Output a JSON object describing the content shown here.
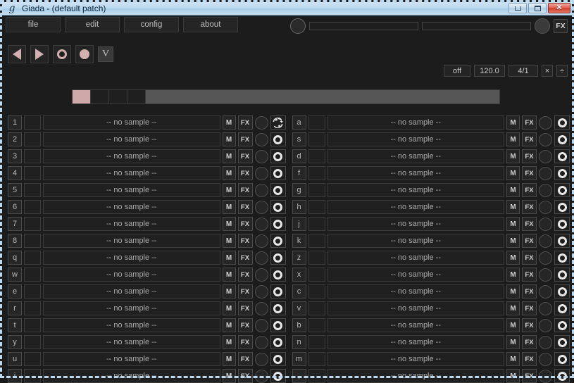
{
  "window": {
    "logo": "g",
    "title": "Giada - (default patch)",
    "buttons": {
      "minimize": "minimize-button",
      "maximize": "maximize-button",
      "close": "✕"
    }
  },
  "menu": {
    "items": [
      {
        "label": "file"
      },
      {
        "label": "edit"
      },
      {
        "label": "config"
      },
      {
        "label": "about"
      }
    ]
  },
  "io": {
    "fx_label": "FX",
    "in_meter": "input-meter",
    "out_meter": "output-meter"
  },
  "transport": {
    "rewind": "rewind-button",
    "play": "play-button",
    "record_action": "action-record-button",
    "record_input": "input-record-button",
    "metronome": "V"
  },
  "bpm_bar": {
    "quantizer": "off",
    "bpm": "120.0",
    "beats": "4/1",
    "multiply": "×",
    "divide": "÷"
  },
  "beat_meter": {
    "total_cells": 4,
    "active_cell": 1
  },
  "channels": {
    "sample_placeholder": "-- no sample --",
    "mute_label": "M",
    "fx_label": "FX",
    "left": [
      {
        "key": "1",
        "sample": "-- no sample --",
        "mode": "loop"
      },
      {
        "key": "2",
        "sample": "-- no sample --",
        "mode": "oneshot"
      },
      {
        "key": "3",
        "sample": "-- no sample --",
        "mode": "oneshot"
      },
      {
        "key": "4",
        "sample": "-- no sample --",
        "mode": "oneshot"
      },
      {
        "key": "5",
        "sample": "-- no sample --",
        "mode": "oneshot"
      },
      {
        "key": "6",
        "sample": "-- no sample --",
        "mode": "oneshot"
      },
      {
        "key": "7",
        "sample": "-- no sample --",
        "mode": "oneshot"
      },
      {
        "key": "8",
        "sample": "-- no sample --",
        "mode": "oneshot"
      },
      {
        "key": "q",
        "sample": "-- no sample --",
        "mode": "oneshot"
      },
      {
        "key": "w",
        "sample": "-- no sample --",
        "mode": "oneshot"
      },
      {
        "key": "e",
        "sample": "-- no sample --",
        "mode": "oneshot"
      },
      {
        "key": "r",
        "sample": "-- no sample --",
        "mode": "oneshot"
      },
      {
        "key": "t",
        "sample": "-- no sample --",
        "mode": "oneshot"
      },
      {
        "key": "y",
        "sample": "-- no sample --",
        "mode": "oneshot"
      },
      {
        "key": "u",
        "sample": "-- no sample --",
        "mode": "oneshot"
      },
      {
        "key": "i",
        "sample": "-- no sample --",
        "mode": "oneshot"
      }
    ],
    "right": [
      {
        "key": "a",
        "sample": "-- no sample --",
        "mode": "oneshot"
      },
      {
        "key": "s",
        "sample": "-- no sample --",
        "mode": "oneshot"
      },
      {
        "key": "d",
        "sample": "-- no sample --",
        "mode": "oneshot"
      },
      {
        "key": "f",
        "sample": "-- no sample --",
        "mode": "oneshot"
      },
      {
        "key": "g",
        "sample": "-- no sample --",
        "mode": "oneshot"
      },
      {
        "key": "h",
        "sample": "-- no sample --",
        "mode": "oneshot"
      },
      {
        "key": "j",
        "sample": "-- no sample --",
        "mode": "oneshot"
      },
      {
        "key": "k",
        "sample": "-- no sample --",
        "mode": "oneshot"
      },
      {
        "key": "z",
        "sample": "-- no sample --",
        "mode": "oneshot"
      },
      {
        "key": "x",
        "sample": "-- no sample --",
        "mode": "oneshot"
      },
      {
        "key": "c",
        "sample": "-- no sample --",
        "mode": "oneshot"
      },
      {
        "key": "v",
        "sample": "-- no sample --",
        "mode": "oneshot"
      },
      {
        "key": "b",
        "sample": "-- no sample --",
        "mode": "oneshot"
      },
      {
        "key": "n",
        "sample": "-- no sample --",
        "mode": "oneshot"
      },
      {
        "key": "m",
        "sample": "-- no sample --",
        "mode": "oneshot"
      },
      {
        "key": ",",
        "sample": "-- no sample --",
        "mode": "oneshot"
      }
    ]
  },
  "colors": {
    "accent": "#cfa9a9",
    "panel": "#1c1c1c",
    "titlebar": "#bcd9ef"
  }
}
